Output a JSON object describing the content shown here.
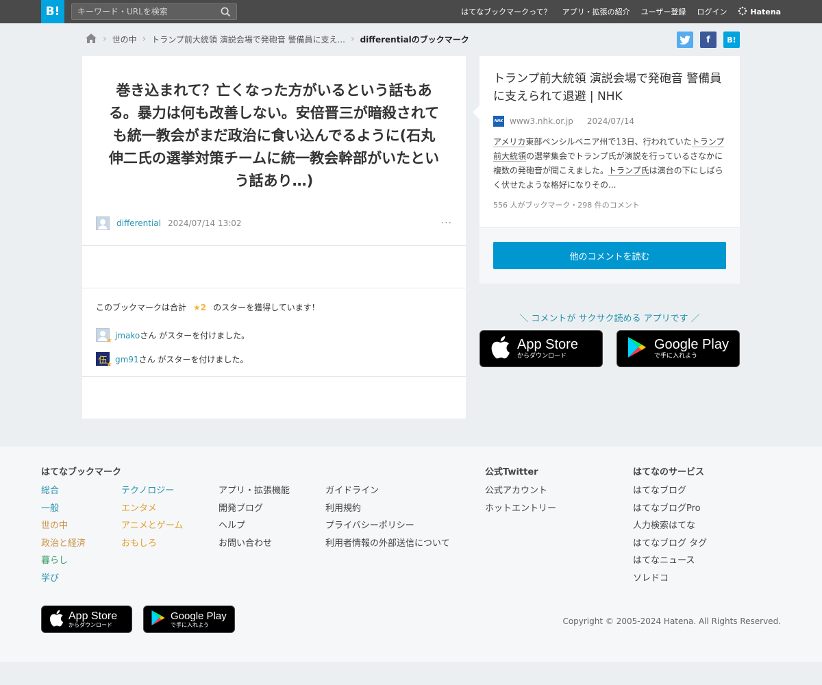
{
  "header": {
    "logo": "B!",
    "search_placeholder": "キーワード・URLを検索",
    "nav": [
      "はてなブックマークって？",
      "アプリ・拡張の紹介",
      "ユーザー登録",
      "ログイン"
    ],
    "brand": "Hatena"
  },
  "breadcrumb": {
    "items": [
      "世の中",
      "トランプ前大統領 演説会場で発砲音 警備員に支え..."
    ],
    "current": "differentialのブックマーク"
  },
  "share": {
    "twitter": "t",
    "facebook": "f",
    "hatena": "B!"
  },
  "comment": {
    "text": "巻き込まれて？亡くなった方がいるという話もある。暴力は何も改善しない。安倍晋三が暗殺されても統一教会がまだ政治に食い込んでるように(石丸伸二氏の選挙対策チームに統一教会幹部がいたという話あり…)",
    "user": "differential",
    "datetime": "2024/07/14 13:02",
    "more": "···"
  },
  "stars": {
    "prefix": "このブックマークは合計",
    "count": "★2",
    "suffix": "のスターを獲得しています！",
    "starrers": [
      {
        "name": "jmako",
        "text": "さん がスターを付けました。"
      },
      {
        "name": "gm91",
        "text": "さん がスターを付けました。"
      }
    ],
    "gm91_avatar": "伍"
  },
  "entry": {
    "title": "トランプ前大統領 演説会場で発砲音 警備員に支えられて退避 | NHK",
    "favicon": "NHK",
    "domain": "www3.nhk.or.jp",
    "date": "2024/07/14",
    "desc_parts": [
      "アメリカ",
      "東部ペンシルベニア州で13日、行われていた",
      "トランプ前大統領",
      "の選挙集会でトランプ氏が演説を行っているさなかに複数の発砲音が聞こえました。",
      "トランプ氏",
      "は演台の下にしばらく伏せたような格好になりその..."
    ],
    "count": "556 人がブックマーク・298 件のコメント",
    "read_button": "他のコメントを読む"
  },
  "promo": {
    "text": "＼ コメントが サクサク読める アプリです ／",
    "appstore_big": "App Store",
    "appstore_small": "からダウンロード",
    "googleplay_big": "Google Play",
    "googleplay_small": "で手に入れよう"
  },
  "footer": {
    "heading_bookmark": "はてなブックマーク",
    "categories_a": [
      {
        "label": "総合",
        "color": "#2592b0"
      },
      {
        "label": "一般",
        "color": "#2592b0"
      },
      {
        "label": "世の中",
        "color": "#c9944a"
      },
      {
        "label": "政治と経済",
        "color": "#c9944a"
      },
      {
        "label": "暮らし",
        "color": "#3a9a6c"
      },
      {
        "label": "学び",
        "color": "#2592b0"
      }
    ],
    "categories_b": [
      {
        "label": "テクノロジー",
        "color": "#2592b0"
      },
      {
        "label": "エンタメ",
        "color": "#e0a030"
      },
      {
        "label": "アニメとゲーム",
        "color": "#e0a030"
      },
      {
        "label": "おもしろ",
        "color": "#e0a030"
      }
    ],
    "links_c": [
      "アプリ・拡張機能",
      "開発ブログ",
      "ヘルプ",
      "お問い合わせ"
    ],
    "links_d": [
      "ガイドライン",
      "利用規約",
      "プライバシーポリシー",
      "利用者情報の外部送信について"
    ],
    "heading_twitter": "公式Twitter",
    "twitter_links": [
      "公式アカウント",
      "ホットエントリー"
    ],
    "heading_services": "はてなのサービス",
    "services": [
      "はてなブログ",
      "はてなブログPro",
      "人力検索はてな",
      "はてなブログ タグ",
      "はてなニュース",
      "ソレドコ"
    ],
    "copyright": "Copyright © 2005-2024 Hatena. All Rights Reserved."
  }
}
